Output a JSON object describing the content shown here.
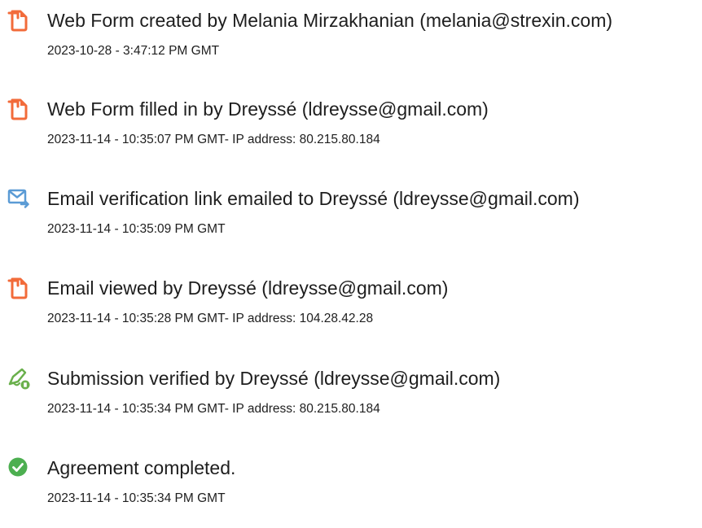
{
  "events": [
    {
      "icon": "document-icon",
      "title": "Web Form created by Melania Mirzakhanian (melania@strexin.com)",
      "meta": "2023-10-28 - 3:47:12 PM GMT"
    },
    {
      "icon": "document-icon",
      "title": "Web Form filled in by Dreyssé (ldreysse@gmail.com)",
      "meta": "2023-11-14 - 10:35:07 PM GMT- IP address: 80.215.80.184"
    },
    {
      "icon": "email-send-icon",
      "title": "Email verification link emailed to Dreyssé (ldreysse@gmail.com)",
      "meta": "2023-11-14 - 10:35:09 PM GMT"
    },
    {
      "icon": "document-icon",
      "title": "Email viewed by Dreyssé (ldreysse@gmail.com)",
      "meta": "2023-11-14 - 10:35:28 PM GMT- IP address: 104.28.42.28"
    },
    {
      "icon": "signature-verified-icon",
      "title": "Submission verified by Dreyssé (ldreysse@gmail.com)",
      "meta": "2023-11-14 - 10:35:34 PM GMT- IP address: 80.215.80.184"
    },
    {
      "icon": "check-circle-icon",
      "title": "Agreement completed.",
      "meta": "2023-11-14 - 10:35:34 PM GMT"
    }
  ],
  "colors": {
    "document_icon": "#f26b3a",
    "email_icon": "#5b9bd5",
    "signature_icon": "#6ab04c",
    "check_icon": "#4caf50",
    "text": "#1e1e1e"
  }
}
